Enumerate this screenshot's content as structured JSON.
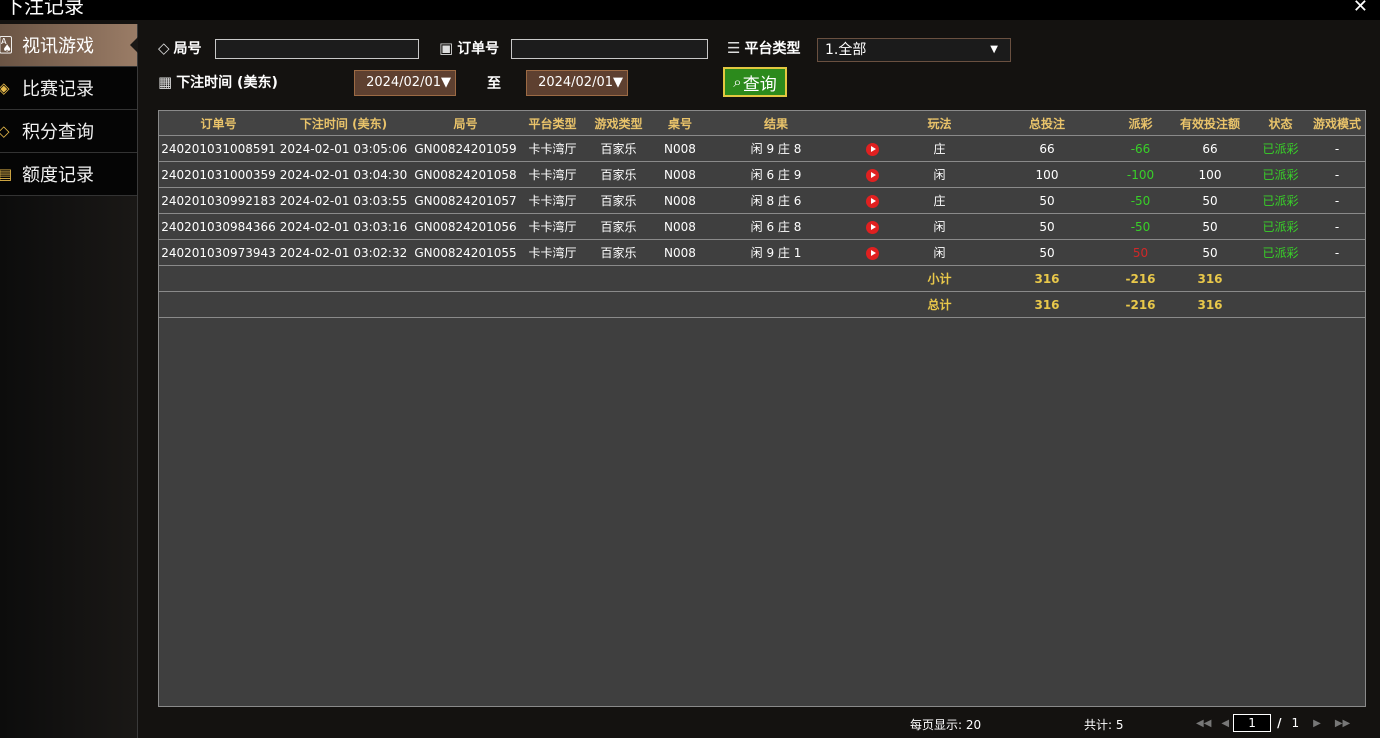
{
  "window": {
    "title": "下注记录",
    "close_glyph": "✕"
  },
  "sidebar": {
    "items": [
      {
        "label": "视讯游戏",
        "icon": "cards-icon",
        "active": true
      },
      {
        "label": "比赛记录",
        "icon": "diamond-tag-icon",
        "active": false
      },
      {
        "label": "积分查询",
        "icon": "gem-icon",
        "active": false
      },
      {
        "label": "额度记录",
        "icon": "document-icon",
        "active": false
      }
    ]
  },
  "filters": {
    "round_label": "局号",
    "round_value": "",
    "order_label": "订单号",
    "order_value": "",
    "platform_label": "平台类型",
    "platform_selected": "1.全部",
    "time_label": "下注时间 (美东)",
    "date_from": "2024/02/01▼",
    "to_label": "至",
    "date_to": "2024/02/01▼",
    "query_label": "查询"
  },
  "table": {
    "headers": [
      "订单号",
      "下注时间 (美东)",
      "局号",
      "平台类型",
      "游戏类型",
      "桌号",
      "结果",
      "",
      "玩法",
      "总投注",
      "派彩",
      "有效投注额",
      "状态",
      "游戏模式"
    ],
    "rows": [
      {
        "order": "240201031008591",
        "time": "2024-02-01 03:05:06",
        "round": "GN00824201059",
        "platform": "卡卡湾厅",
        "game": "百家乐",
        "table": "N008",
        "result": "闲 9 庄 8",
        "play": "庄",
        "bet": "66",
        "payout": "-66",
        "valid": "66",
        "status": "已派彩",
        "mode": "-"
      },
      {
        "order": "240201031000359",
        "time": "2024-02-01 03:04:30",
        "round": "GN00824201058",
        "platform": "卡卡湾厅",
        "game": "百家乐",
        "table": "N008",
        "result": "闲 6 庄 9",
        "play": "闲",
        "bet": "100",
        "payout": "-100",
        "valid": "100",
        "status": "已派彩",
        "mode": "-"
      },
      {
        "order": "240201030992183",
        "time": "2024-02-01 03:03:55",
        "round": "GN00824201057",
        "platform": "卡卡湾厅",
        "game": "百家乐",
        "table": "N008",
        "result": "闲 8 庄 6",
        "play": "庄",
        "bet": "50",
        "payout": "-50",
        "valid": "50",
        "status": "已派彩",
        "mode": "-"
      },
      {
        "order": "240201030984366",
        "time": "2024-02-01 03:03:16",
        "round": "GN00824201056",
        "platform": "卡卡湾厅",
        "game": "百家乐",
        "table": "N008",
        "result": "闲 6 庄 8",
        "play": "闲",
        "bet": "50",
        "payout": "-50",
        "valid": "50",
        "status": "已派彩",
        "mode": "-"
      },
      {
        "order": "240201030973943",
        "time": "2024-02-01 03:02:32",
        "round": "GN00824201055",
        "platform": "卡卡湾厅",
        "game": "百家乐",
        "table": "N008",
        "result": "闲 9 庄 1",
        "play": "闲",
        "bet": "50",
        "payout": "50",
        "valid": "50",
        "status": "已派彩",
        "mode": "-"
      }
    ],
    "subtotal": {
      "label": "小计",
      "bet": "316",
      "payout": "-216",
      "valid": "316"
    },
    "total": {
      "label": "总计",
      "bet": "316",
      "payout": "-216",
      "valid": "316"
    }
  },
  "footer": {
    "per_page": "每页显示: 20",
    "count": "共计: 5",
    "page": "1",
    "slash": "/",
    "total_pages": "1"
  },
  "colors": {
    "accent_gold": "#e9c36a",
    "win_green": "#38d028",
    "loss_red": "#d02828",
    "query_green": "#2c8a1c"
  }
}
